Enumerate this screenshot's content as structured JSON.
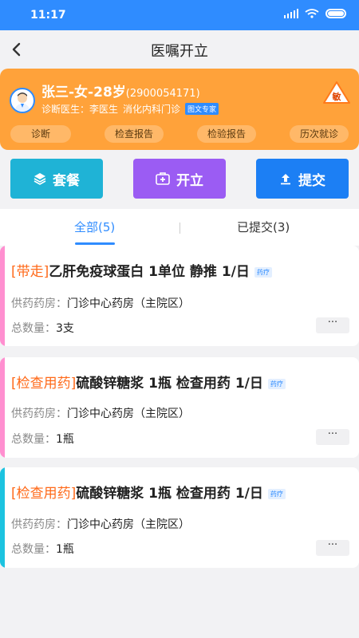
{
  "status_bar": {
    "time": "11:17"
  },
  "header": {
    "title": "医嘱开立"
  },
  "patient": {
    "name": "张三-女-28岁",
    "id": "(2900054171)",
    "doctor": "诊断医生：李医生",
    "clinic": "消化内科门诊",
    "expert_tag": "图文专家",
    "allergy": "敏"
  },
  "quick_actions": [
    "诊断",
    "检查报告",
    "检验报告",
    "历次就诊"
  ],
  "actions": {
    "package": "套餐",
    "issue": "开立",
    "submit": "提交"
  },
  "tabs": {
    "all": "全部(5)",
    "submitted": "已提交(3)"
  },
  "orders": [
    {
      "tag": "[带走]",
      "name": "乙肝免疫球蛋白  1单位  静推  1/日",
      "badge": "药疗",
      "pharmacy_label": "供药药房：",
      "pharmacy": "门诊中心药房（主院区）",
      "total_label": "总数量：",
      "total": "3支",
      "more": "···",
      "stripe_color": "#ff8fd0"
    },
    {
      "tag": "[检查用药]",
      "name": "硫酸锌糖浆 1瓶 检查用药 1/日",
      "badge": "药疗",
      "pharmacy_label": "供药药房：",
      "pharmacy": "门诊中心药房（主院区）",
      "total_label": "总数量：",
      "total": "1瓶",
      "more": "···",
      "stripe_color": "#ff8fd0"
    },
    {
      "tag": "[检查用药]",
      "name": "硫酸锌糖浆 1瓶 检查用药 1/日",
      "badge": "药疗",
      "pharmacy_label": "供药药房：",
      "pharmacy": "门诊中心药房（主院区）",
      "total_label": "总数量：",
      "total": "1瓶",
      "more": "···",
      "stripe_color": "#1cc3e0"
    }
  ],
  "colors": {
    "primary": "#2f8cff",
    "card_orange": "#ffa23a",
    "tag_orange": "#ff6a1a",
    "package_btn": "#1fb3d6",
    "issue_btn": "#9b5cf3",
    "submit_btn": "#1c7ff4"
  }
}
